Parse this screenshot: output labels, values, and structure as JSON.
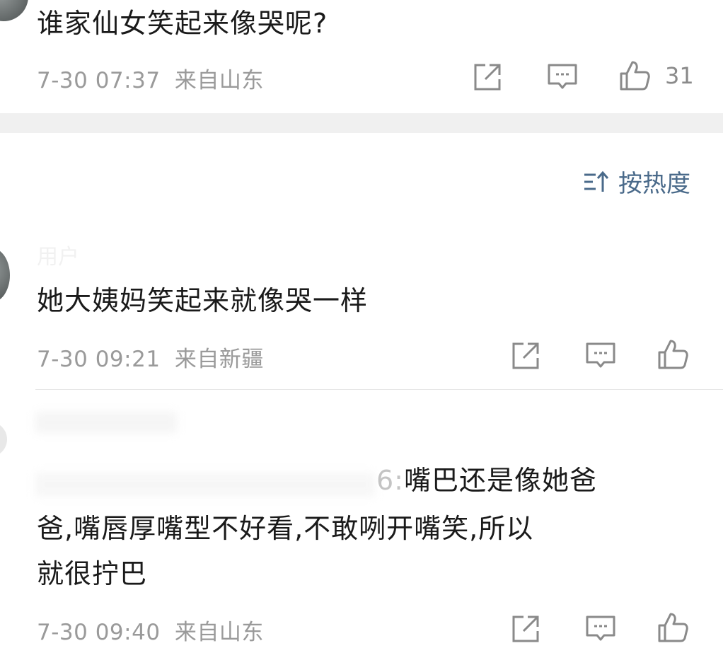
{
  "comment1": {
    "text": "谁家仙女笑起来像哭呢?",
    "time": "7-30 07:37",
    "location": "来自山东",
    "likes": "31"
  },
  "sort": {
    "label": "按热度"
  },
  "comment2": {
    "username": "用户",
    "text": "她大姨妈笑起来就像哭一样",
    "time": "7-30 09:21",
    "location": "来自新疆"
  },
  "comment3": {
    "reply_prefix": "6:",
    "line1": "嘴巴还是像她爸",
    "line2": "爸,嘴唇厚嘴型不好看,不敢咧开嘴笑,所以",
    "line3": "就很拧巴",
    "time": "7-30 09:40",
    "location": "来自山东"
  },
  "icons": {
    "share": "share-icon",
    "comment": "comment-icon",
    "like": "thumbs-up-icon",
    "sort": "sort-icon"
  }
}
